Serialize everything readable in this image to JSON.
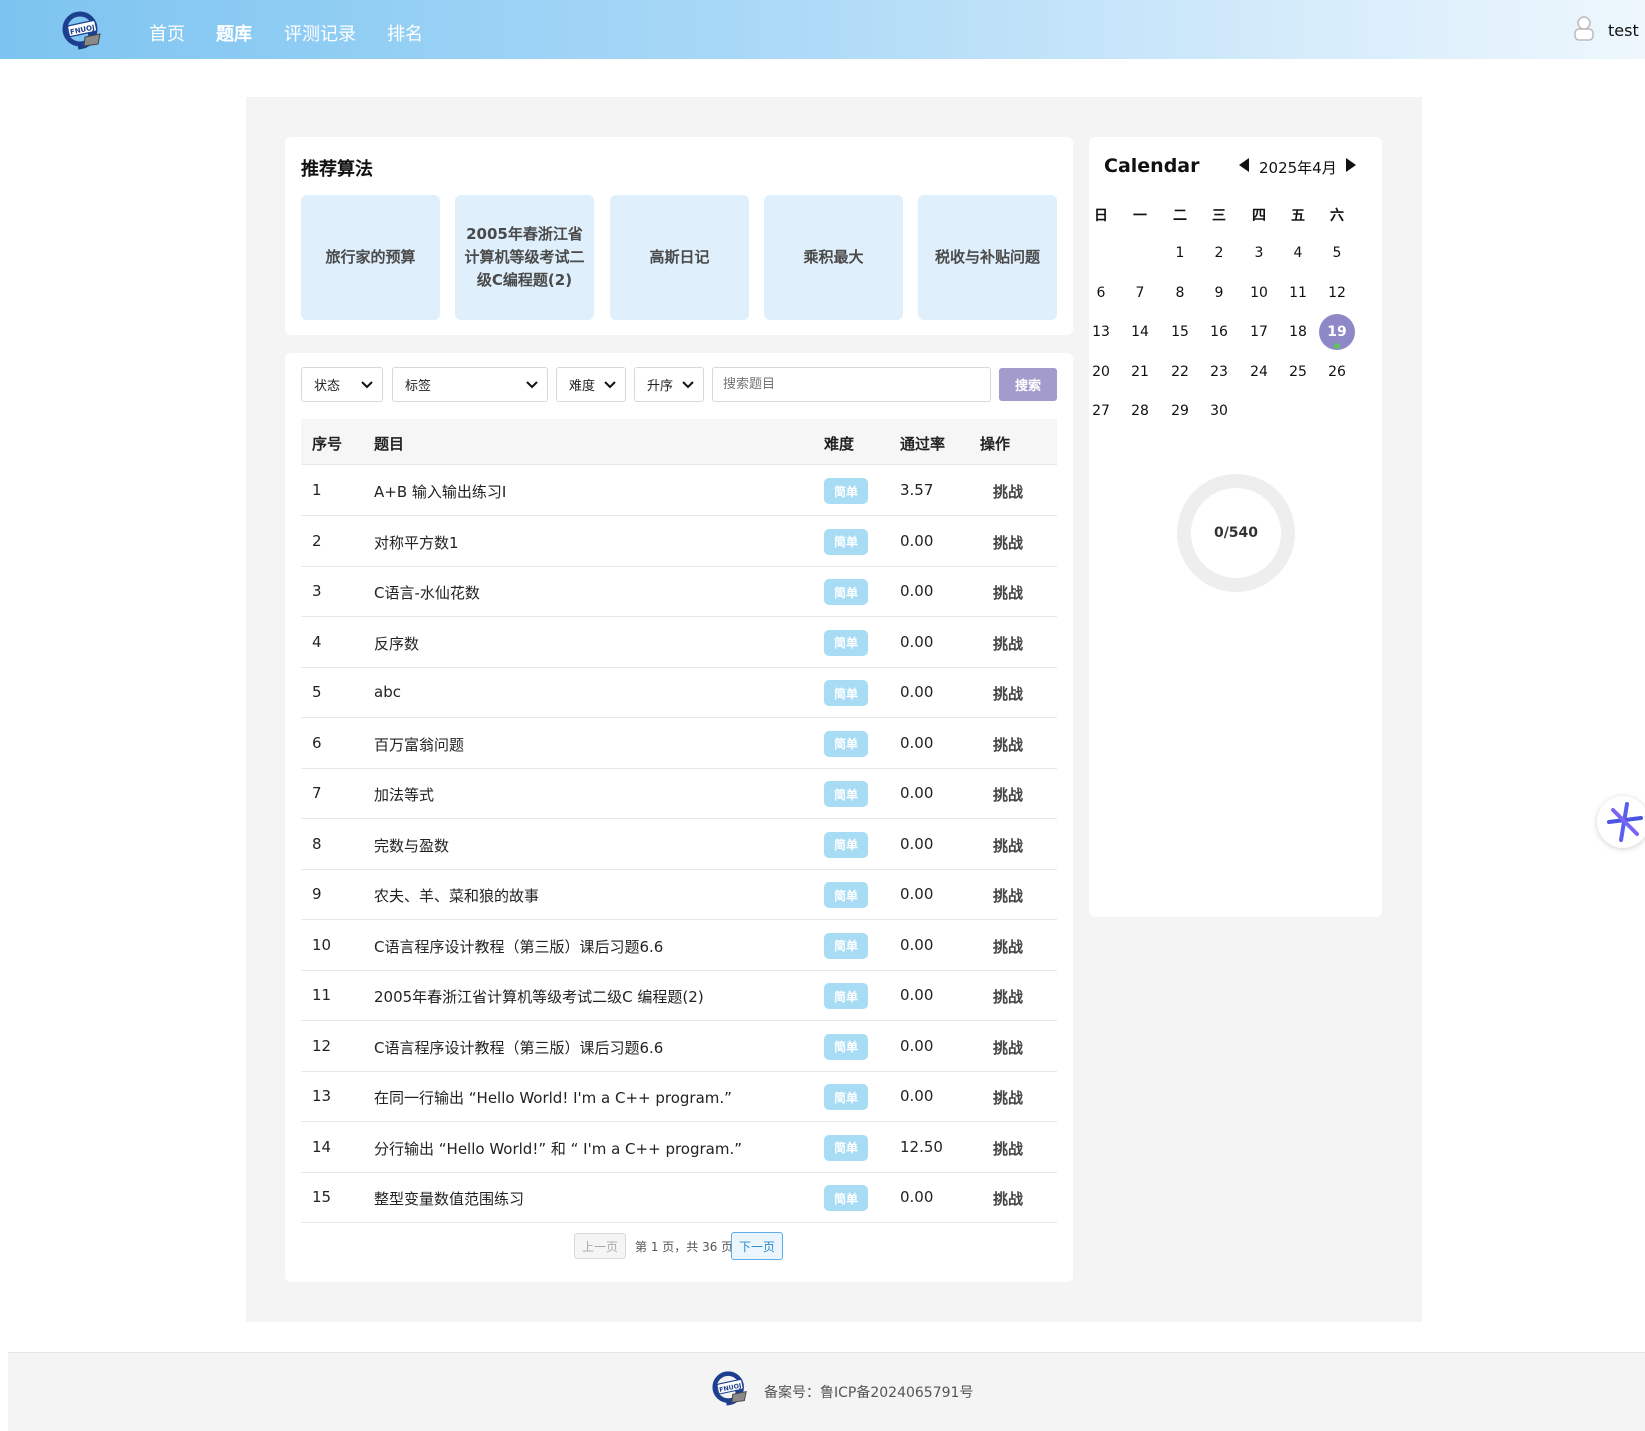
{
  "nav": {
    "items": [
      {
        "label": "首页",
        "active": false
      },
      {
        "label": "题库",
        "active": true
      },
      {
        "label": "评测记录",
        "active": false
      },
      {
        "label": "排名",
        "active": false
      }
    ],
    "user": "test",
    "logo_text": "FNUOJ"
  },
  "recommend": {
    "title": "推荐算法",
    "items": [
      "旅行家的预算",
      "2005年春浙江省计算机等级考试二级C编程题(2)",
      "高斯日记",
      "乘积最大",
      "税收与补贴问题"
    ]
  },
  "filters": {
    "status": "状态",
    "tags": "标签",
    "difficulty": "难度",
    "order": "升序",
    "search_placeholder": "搜索题目",
    "search_button": "搜索"
  },
  "table": {
    "headers": {
      "index": "序号",
      "title": "题目",
      "difficulty": "难度",
      "pass_rate": "通过率",
      "action": "操作"
    },
    "rows": [
      {
        "index": "1",
        "title": "A+B 输入输出练习I",
        "difficulty": "简单",
        "pass_rate": "3.57",
        "action": "挑战"
      },
      {
        "index": "2",
        "title": "对称平方数1",
        "difficulty": "简单",
        "pass_rate": "0.00",
        "action": "挑战"
      },
      {
        "index": "3",
        "title": "C语言-水仙花数",
        "difficulty": "简单",
        "pass_rate": "0.00",
        "action": "挑战"
      },
      {
        "index": "4",
        "title": "反序数",
        "difficulty": "简单",
        "pass_rate": "0.00",
        "action": "挑战"
      },
      {
        "index": "5",
        "title": "abc",
        "difficulty": "简单",
        "pass_rate": "0.00",
        "action": "挑战"
      },
      {
        "index": "6",
        "title": "百万富翁问题",
        "difficulty": "简单",
        "pass_rate": "0.00",
        "action": "挑战"
      },
      {
        "index": "7",
        "title": "加法等式",
        "difficulty": "简单",
        "pass_rate": "0.00",
        "action": "挑战"
      },
      {
        "index": "8",
        "title": "完数与盈数",
        "difficulty": "简单",
        "pass_rate": "0.00",
        "action": "挑战"
      },
      {
        "index": "9",
        "title": "农夫、羊、菜和狼的故事",
        "difficulty": "简单",
        "pass_rate": "0.00",
        "action": "挑战"
      },
      {
        "index": "10",
        "title": "C语言程序设计教程（第三版）课后习题6.6",
        "difficulty": "简单",
        "pass_rate": "0.00",
        "action": "挑战"
      },
      {
        "index": "11",
        "title": "2005年春浙江省计算机等级考试二级C 编程题(2)",
        "difficulty": "简单",
        "pass_rate": "0.00",
        "action": "挑战"
      },
      {
        "index": "12",
        "title": "C语言程序设计教程（第三版）课后习题6.6",
        "difficulty": "简单",
        "pass_rate": "0.00",
        "action": "挑战"
      },
      {
        "index": "13",
        "title": "在同一行输出 “Hello World! I'm a C++ program.”",
        "difficulty": "简单",
        "pass_rate": "0.00",
        "action": "挑战"
      },
      {
        "index": "14",
        "title": "分行输出 “Hello World!” 和 “ I'm a C++ program.”",
        "difficulty": "简单",
        "pass_rate": "12.50",
        "action": "挑战"
      },
      {
        "index": "15",
        "title": "整型变量数值范围练习",
        "difficulty": "简单",
        "pass_rate": "0.00",
        "action": "挑战"
      }
    ]
  },
  "pagination": {
    "prev": "上一页",
    "info": "第 1 页，共 36 页",
    "next": "下一页"
  },
  "calendar": {
    "title": "Calendar",
    "month": "2025年4月",
    "weekdays": [
      "日",
      "一",
      "二",
      "三",
      "四",
      "五",
      "六"
    ],
    "first_weekday": 2,
    "days": 30,
    "today": 19
  },
  "progress": {
    "solved": 0,
    "total": 540,
    "label": "0/540"
  },
  "footer": {
    "icp": "备案号：鲁ICP备2024065791号"
  },
  "colors": {
    "accent": "#8e89c6",
    "badge": "#a8dcf5",
    "recommend_bg": "#dff0fc",
    "search_button": "#a39bcc"
  }
}
